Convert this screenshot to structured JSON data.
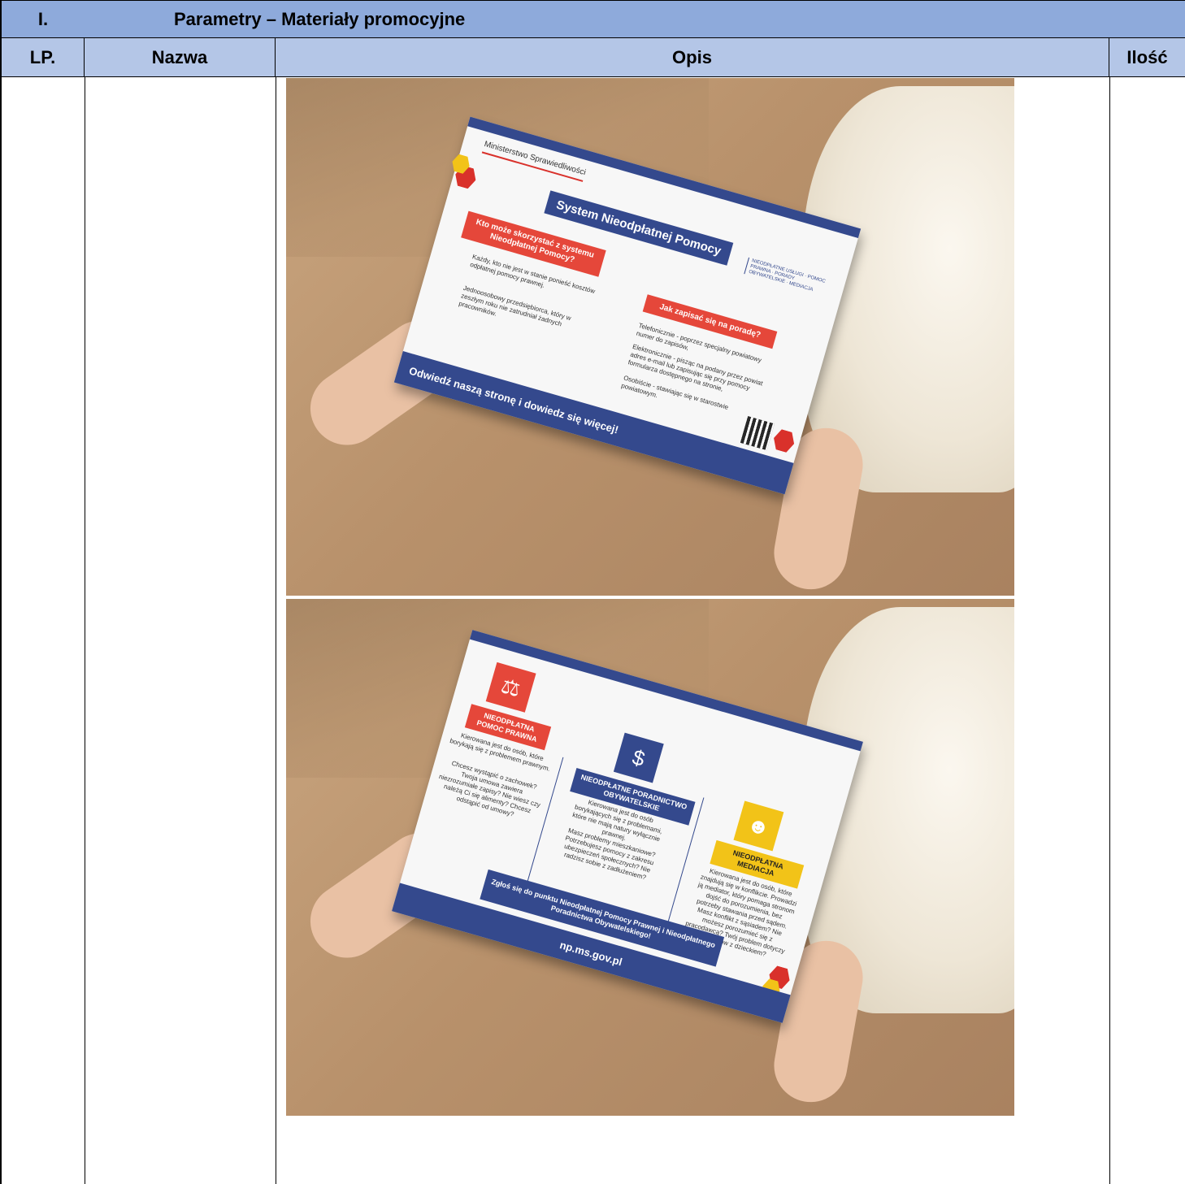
{
  "table": {
    "section_number": "I.",
    "section_title": "Parametry – Materiały promocyjne",
    "headers": {
      "lp": "LP.",
      "nazwa": "Nazwa",
      "opis": "Opis",
      "ilosc": "Ilość"
    }
  },
  "photo1": {
    "ministry": "Ministerstwo Sprawiedliwości",
    "title": "System Nieodpłatnej Pomocy",
    "who_label": "Kto może skorzystać z systemu Nieodpłatnej Pomocy?",
    "who_item1": "Każdy, kto nie jest w stanie ponieść kosztów odpłatnej pomocy prawnej.",
    "who_item2": "Jednoosobowy przedsiębiorca, który w zeszłym roku nie zatrudniał żadnych pracowników.",
    "how_label": "Jak zapisać się na poradę?",
    "how_phone": "Telefonicznie - poprzez specjalny powiatowy numer do zapisów,",
    "how_email": "Elektronicznie - pisząc na podany przez powiat adres e-mail lub zapisując się przy pomocy formularza dostępnego na stronie,",
    "how_person": "Osobiście - stawiając się w starostwie powiatowym.",
    "logo_text": "NIEODPŁATNE USŁUGI · POMOC PRAWNA · PORADY OBYWATELSKIE · MEDIACJA",
    "footer": "Odwiedź naszą stronę i dowiedz się więcej!"
  },
  "photo2": {
    "col1_label": "NIEODPŁATNA POMOC PRAWNA",
    "col1_text": "Kierowana jest do osób, które borykają się z problemem prawnym.",
    "col1_q": "Chcesz wystąpić o zachowek? Twoja umowa zawiera niezrozumiałe zapisy? Nie wiesz czy należą Ci się alimenty? Chcesz odstąpić od umowy?",
    "col2_label": "NIEODPŁATNE PORADNICTWO OBYWATELSKIE",
    "col2_text": "Kierowana jest do osób borykających się z problemami, które nie mają natury wyłącznie prawnej.",
    "col2_q": "Masz problemy mieszkaniowe? Potrzebujesz pomocy z zakresu ubezpieczeń społecznych? Nie radzisz sobie z zadłużeniem?",
    "col3_label": "NIEODPŁATNA MEDIACJA",
    "col3_text": "Kierowana jest do osób, które znajdują się w konflikcie. Prowadzi ją mediator, który pomaga stronom dojść do porozumienia, bez potrzeby stawania przed sądem.",
    "col3_q": "Masz konflikt z sąsiadem? Nie możesz porozumieć się z pracodawcą? Twój problem dotyczy kontaktów z dzieckiem?",
    "cta": "Zgłoś się do punktu Nieodpłatnej Pomocy Prawnej i Nieodpłatnego Poradnictwa Obywatelskiego!",
    "url": "np.ms.gov.pl"
  },
  "colors": {
    "title_bg": "#8eaadb",
    "header_bg": "#b4c6e7",
    "navy": "#34498d",
    "red": "#e5473a",
    "yellow": "#f2c318"
  }
}
